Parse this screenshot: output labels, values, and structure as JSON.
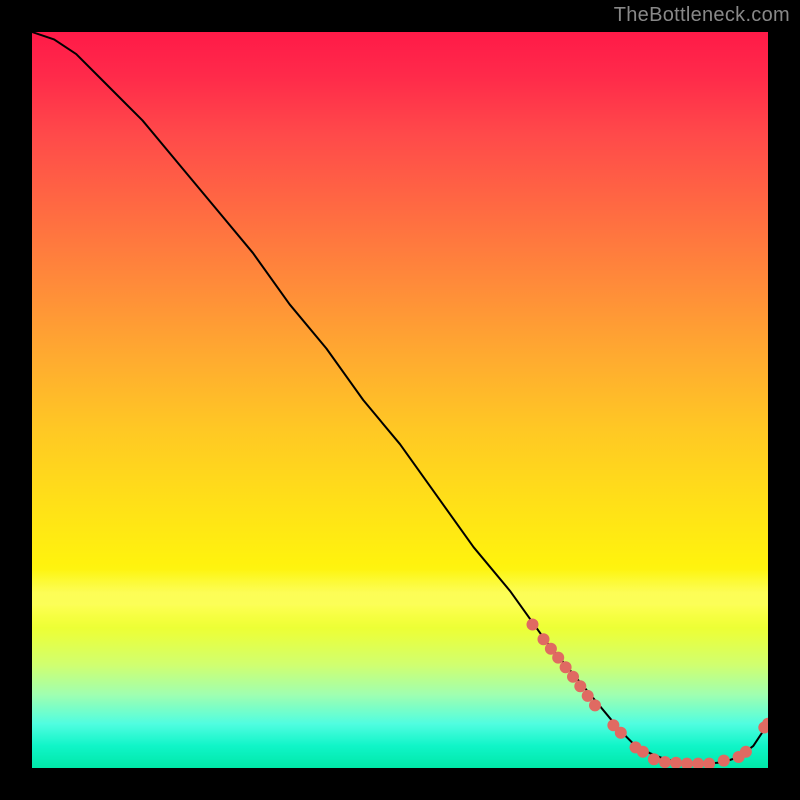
{
  "watermark": "TheBottleneck.com",
  "chart_data": {
    "type": "line",
    "title": "",
    "xlabel": "",
    "ylabel": "",
    "xlim": [
      0,
      100
    ],
    "ylim": [
      0,
      100
    ],
    "grid": false,
    "legend": false,
    "series": [
      {
        "name": "bottleneck-curve",
        "color": "#000000",
        "x": [
          0,
          3,
          6,
          10,
          15,
          20,
          25,
          30,
          35,
          40,
          45,
          50,
          55,
          60,
          65,
          70,
          75,
          80,
          82,
          84,
          86,
          88,
          90,
          92,
          94,
          96,
          98,
          100
        ],
        "y": [
          100,
          99,
          97,
          93,
          88,
          82,
          76,
          70,
          63,
          57,
          50,
          44,
          37,
          30,
          24,
          17,
          11,
          5,
          3,
          2,
          1.2,
          0.8,
          0.6,
          0.6,
          0.8,
          1.5,
          3,
          6
        ]
      }
    ],
    "scatter_points": {
      "name": "highlight-dots",
      "color": "#e06a62",
      "radius": 6,
      "points": [
        [
          68,
          19.5
        ],
        [
          69.5,
          17.5
        ],
        [
          70.5,
          16.2
        ],
        [
          71.5,
          15.0
        ],
        [
          72.5,
          13.7
        ],
        [
          73.5,
          12.4
        ],
        [
          74.5,
          11.1
        ],
        [
          75.5,
          9.8
        ],
        [
          76.5,
          8.5
        ],
        [
          79,
          5.8
        ],
        [
          80,
          4.8
        ],
        [
          82,
          2.8
        ],
        [
          83,
          2.2
        ],
        [
          84.5,
          1.2
        ],
        [
          86,
          0.8
        ],
        [
          87.5,
          0.7
        ],
        [
          89,
          0.6
        ],
        [
          90.5,
          0.6
        ],
        [
          92,
          0.6
        ],
        [
          94,
          1.0
        ],
        [
          96,
          1.5
        ],
        [
          97,
          2.2
        ],
        [
          99.5,
          5.5
        ],
        [
          100,
          6
        ]
      ]
    },
    "background": {
      "type": "vertical-gradient",
      "top_color": "#ff1a48",
      "mid_color": "#ffe018",
      "bottom_color": "#00e8a8"
    }
  }
}
